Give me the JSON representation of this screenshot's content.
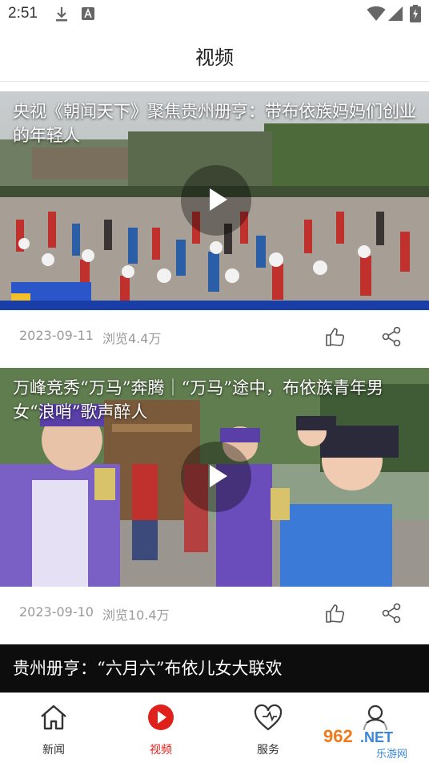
{
  "status_bar": {
    "time": "2:51",
    "icons": [
      "download-icon",
      "text-a-icon",
      "wifi-icon",
      "signal-icon",
      "battery-charging-icon"
    ]
  },
  "header": {
    "title": "视频"
  },
  "feed": {
    "items": [
      {
        "caption": "央视《朝闻天下》聚焦贵州册亨：带布依族妈妈们创业的年轻人",
        "date": "2023-09-11",
        "views": "浏览4.4万",
        "icons": [
          "play-icon",
          "thumbs-up-icon",
          "share-icon"
        ]
      },
      {
        "caption": "万峰竞秀“万马”奔腾｜“万马”途中，布依族青年男女“浪哨”歌声醉人",
        "date": "2023-09-10",
        "views": "浏览10.4万",
        "icons": [
          "play-icon",
          "thumbs-up-icon",
          "share-icon"
        ]
      },
      {
        "caption": "贵州册亨：“六月六”布依儿女大联欢"
      }
    ]
  },
  "bottom_nav": {
    "items": [
      {
        "label": "新闻",
        "icon": "home-icon",
        "active": false
      },
      {
        "label": "视频",
        "icon": "video-play-icon",
        "active": true
      },
      {
        "label": "服务",
        "icon": "heart-icon",
        "active": false
      },
      {
        "label": "",
        "icon": "user-icon",
        "active": false
      }
    ]
  },
  "watermark": {
    "text": "962.NET",
    "subtext": "乐游网"
  },
  "colors": {
    "accent": "#e0201b",
    "meta_text": "#9a9a9a",
    "divider": "#e4e4e4"
  }
}
